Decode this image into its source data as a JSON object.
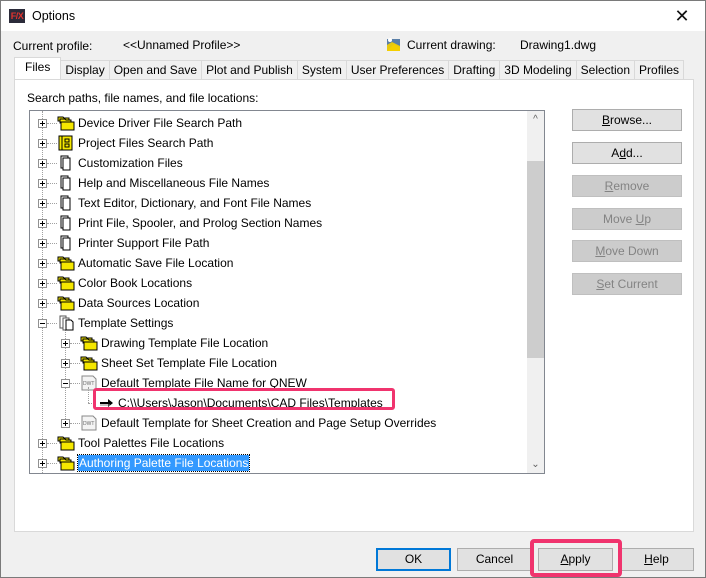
{
  "window": {
    "title": "Options",
    "app_icon": "F/X",
    "close_glyph": "✕"
  },
  "header": {
    "profile_label": "Current profile:",
    "profile_value": "<<Unnamed Profile>>",
    "drawing_label": "Current drawing:",
    "drawing_value": "Drawing1.dwg"
  },
  "tabs": [
    {
      "label": "Files",
      "active": true
    },
    {
      "label": "Display"
    },
    {
      "label": "Open and Save"
    },
    {
      "label": "Plot and Publish"
    },
    {
      "label": "System"
    },
    {
      "label": "User Preferences"
    },
    {
      "label": "Drafting"
    },
    {
      "label": "3D Modeling"
    },
    {
      "label": "Selection"
    },
    {
      "label": "Profiles"
    }
  ],
  "panel": {
    "label": "Search paths, file names, and file locations:"
  },
  "tree": [
    {
      "label": "Device Driver File Search Path",
      "icon": "folder-stack-yellow",
      "level": 0,
      "expander": "plus"
    },
    {
      "label": "Project Files Search Path",
      "icon": "project-files",
      "level": 0,
      "expander": "plus"
    },
    {
      "label": "Customization Files",
      "icon": "document-stack",
      "level": 0,
      "expander": "plus"
    },
    {
      "label": "Help and Miscellaneous File Names",
      "icon": "document-stack",
      "level": 0,
      "expander": "plus"
    },
    {
      "label": "Text Editor, Dictionary, and Font File Names",
      "icon": "document-stack",
      "level": 0,
      "expander": "plus"
    },
    {
      "label": "Print File, Spooler, and Prolog Section Names",
      "icon": "document-stack",
      "level": 0,
      "expander": "plus"
    },
    {
      "label": "Printer Support File Path",
      "icon": "document-stack",
      "level": 0,
      "expander": "plus"
    },
    {
      "label": "Automatic Save File Location",
      "icon": "folder-stack-yellow",
      "level": 0,
      "expander": "plus"
    },
    {
      "label": "Color Book Locations",
      "icon": "folder-stack-yellow",
      "level": 0,
      "expander": "plus"
    },
    {
      "label": "Data Sources Location",
      "icon": "folder-stack-yellow",
      "level": 0,
      "expander": "plus"
    },
    {
      "label": "Template Settings",
      "icon": "template-pages",
      "level": 0,
      "expander": "minus"
    },
    {
      "label": "Drawing Template File Location",
      "icon": "folder-stack-yellow",
      "level": 1,
      "expander": "plus"
    },
    {
      "label": "Sheet Set Template File Location",
      "icon": "folder-stack-yellow",
      "level": 1,
      "expander": "plus"
    },
    {
      "label": "Default Template File Name for QNEW",
      "icon": "dwt-file",
      "level": 1,
      "expander": "minus"
    },
    {
      "label": "C:\\\\Users\\Jason\\Documents\\CAD Files\\Templates",
      "icon": "arrow-right",
      "level": 2,
      "expander": "none",
      "highlighted": true
    },
    {
      "label": "Default Template for Sheet Creation and Page Setup Overrides",
      "icon": "dwt-file",
      "level": 1,
      "expander": "plus"
    },
    {
      "label": "Tool Palettes File Locations",
      "icon": "folder-stack-yellow",
      "level": 0,
      "expander": "plus"
    },
    {
      "label": "Authoring Palette File Locations",
      "icon": "folder-stack-yellow",
      "level": 0,
      "expander": "plus",
      "selected": true
    }
  ],
  "side_buttons": [
    {
      "label_pre": "",
      "label_u": "B",
      "label_post": "rowse...",
      "disabled": false
    },
    {
      "label_pre": "A",
      "label_u": "d",
      "label_post": "d...",
      "disabled": false
    },
    {
      "label_pre": "",
      "label_u": "R",
      "label_post": "emove",
      "disabled": true
    },
    {
      "label_pre": "Move ",
      "label_u": "U",
      "label_post": "p",
      "disabled": true
    },
    {
      "label_pre": "",
      "label_u": "M",
      "label_post": "ove Down",
      "disabled": true
    },
    {
      "label_pre": "",
      "label_u": "S",
      "label_post": "et Current",
      "disabled": true
    }
  ],
  "bottom_buttons": {
    "ok": "OK",
    "cancel": "Cancel",
    "apply_u": "A",
    "apply_rest": "pply",
    "help_u": "H",
    "help_rest": "elp"
  },
  "colors": {
    "highlight": "#f0346e",
    "selection": "#3399ff",
    "default_button_border": "#0078d7"
  }
}
